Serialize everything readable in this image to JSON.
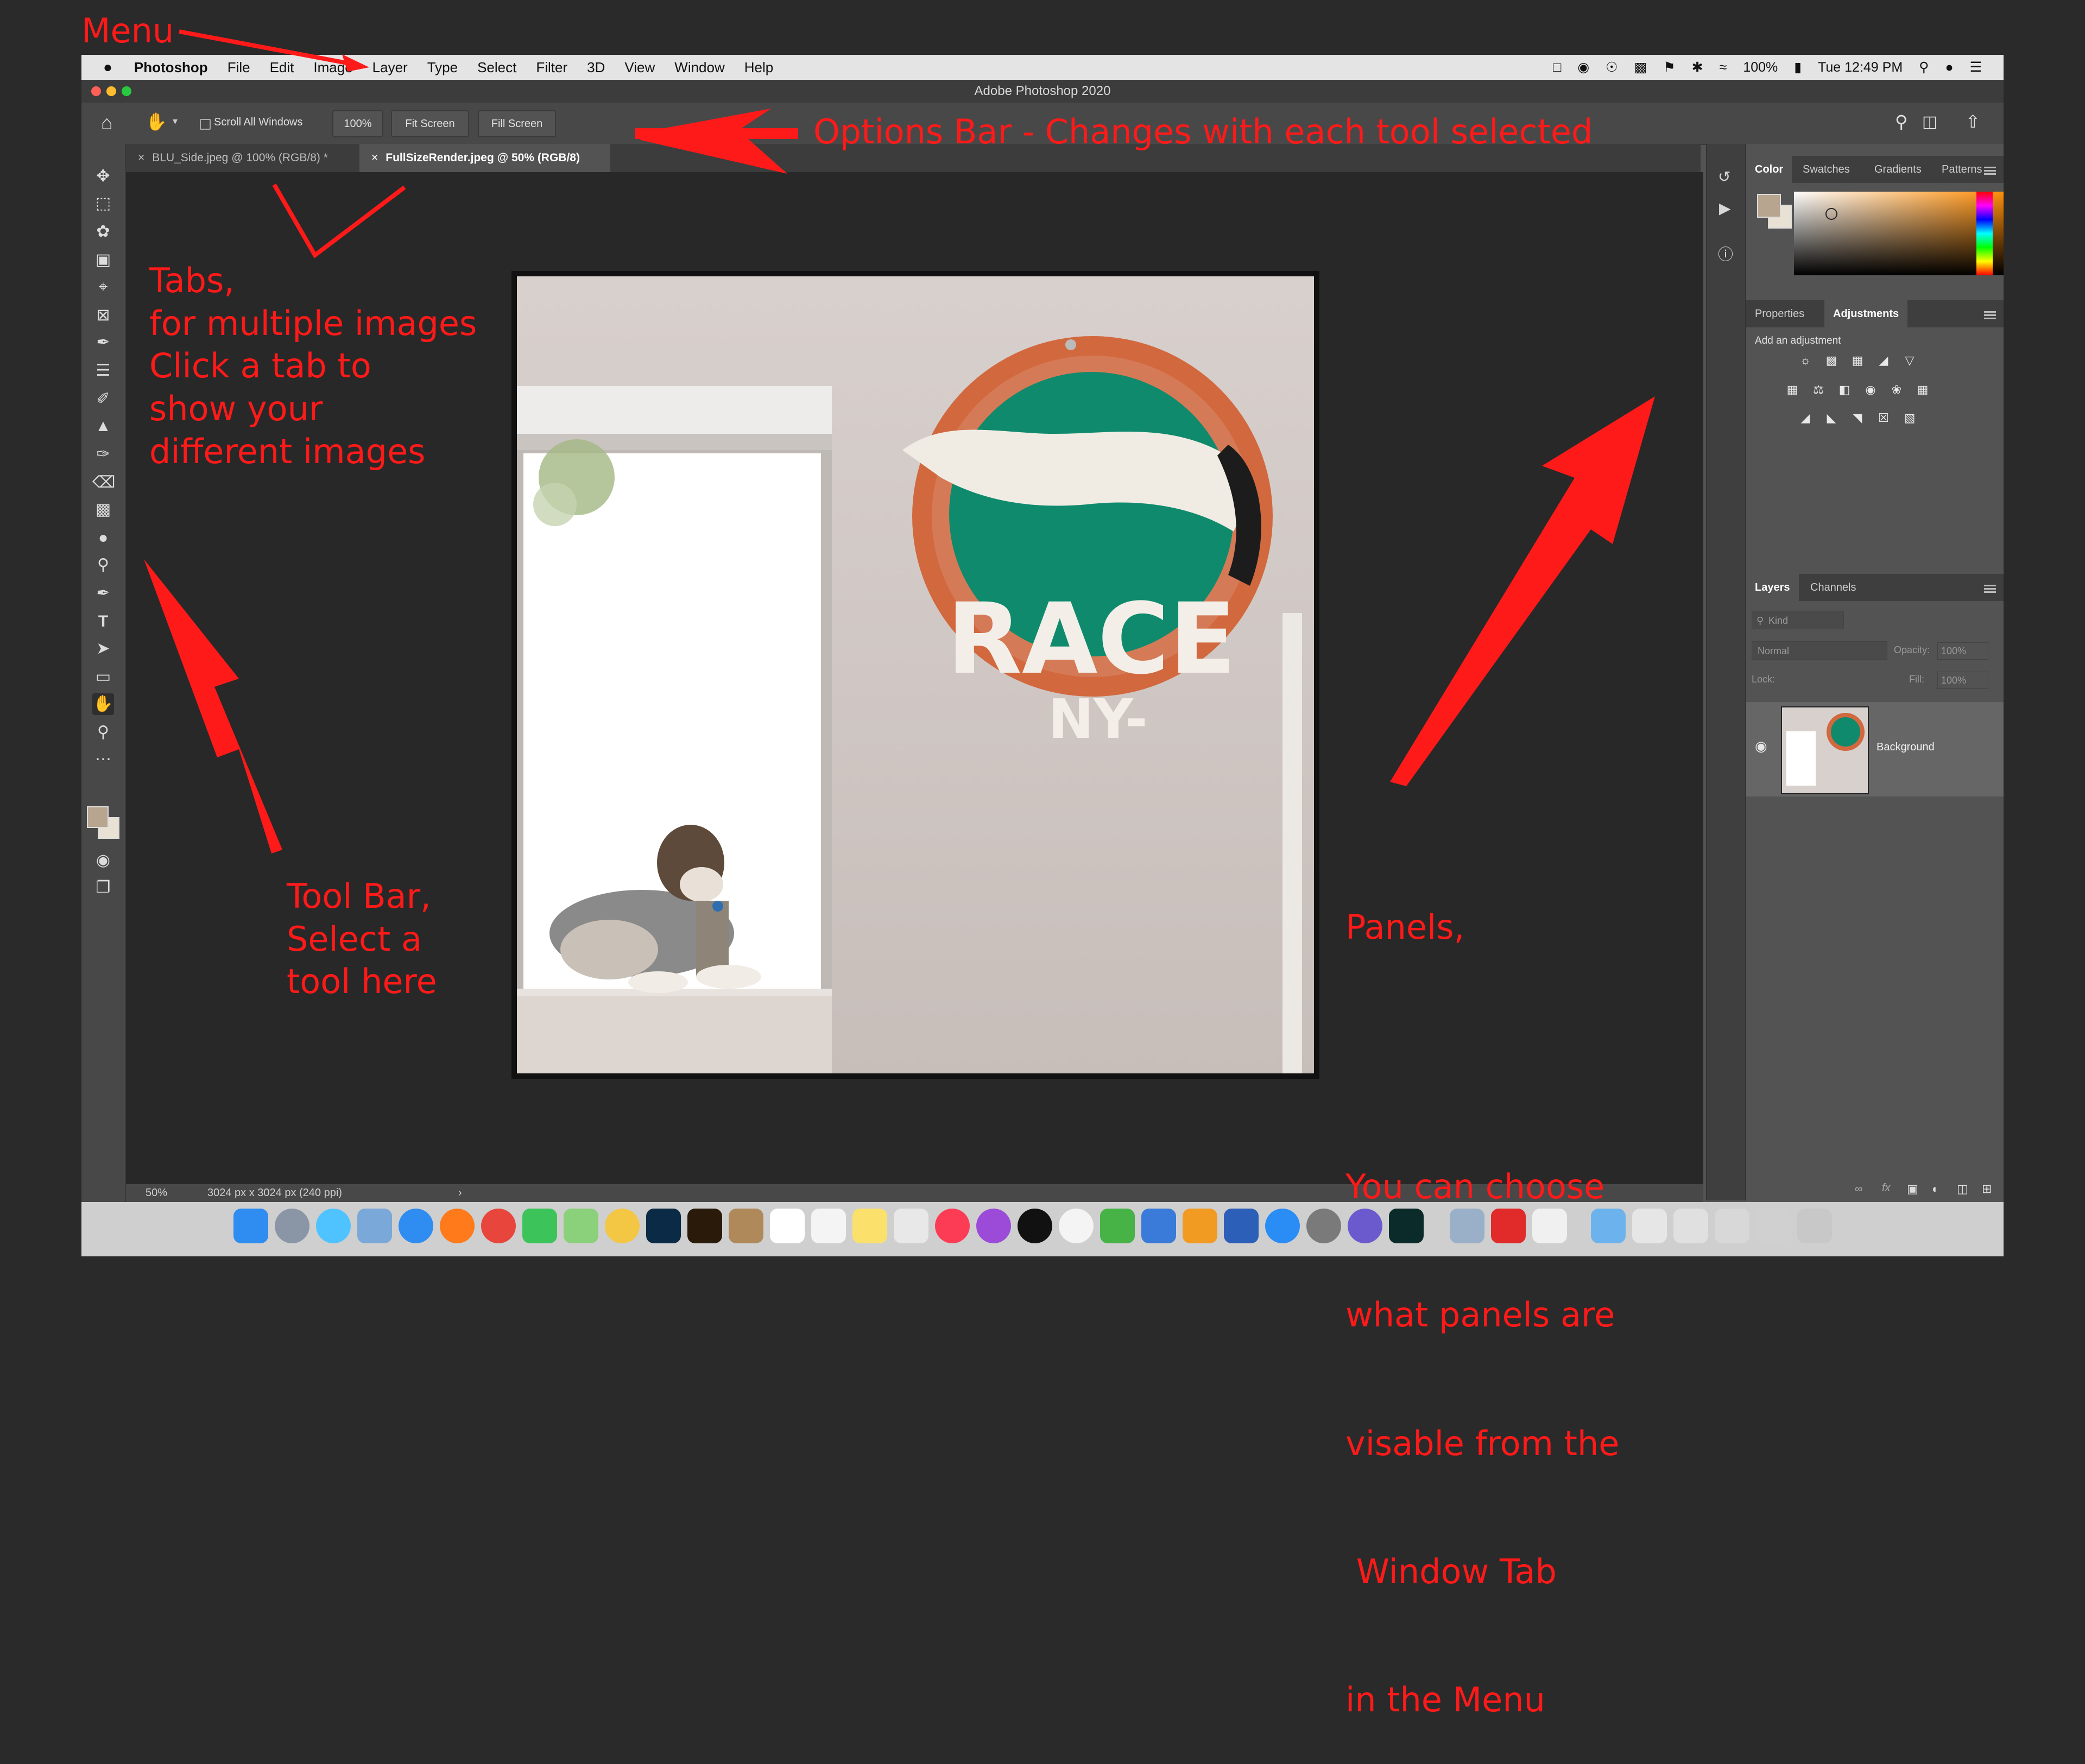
{
  "annotations": {
    "menu": "Menu",
    "options_bar": "Options Bar - Changes with each tool selected",
    "tabs": [
      "Tabs,",
      "for multiple images",
      "Click a tab to",
      "show your",
      "different images"
    ],
    "toolbar": [
      "Tool Bar,",
      "Select a",
      "tool here"
    ],
    "panels": [
      "Panels,",
      "",
      "You can choose",
      "what panels are",
      "visable from the",
      " Window Tab",
      "in the Menu"
    ]
  },
  "menubar": {
    "apple_icon": "apple-logo-icon",
    "items": [
      "Photoshop",
      "File",
      "Edit",
      "Image",
      "Layer",
      "Type",
      "Select",
      "Filter",
      "3D",
      "View",
      "Window",
      "Help"
    ],
    "battery": "100%",
    "clock": "Tue 12:49 PM"
  },
  "window": {
    "title": "Adobe Photoshop 2020"
  },
  "options_bar": {
    "scroll_all": "Scroll All Windows",
    "zoom": "100%",
    "fit_screen": "Fit Screen",
    "fill_screen": "Fill Screen"
  },
  "tabs": [
    {
      "label": "BLU_Side.jpeg @ 100% (RGB/8) *",
      "active": false
    },
    {
      "label": "FullSizeRender.jpeg @ 50% (RGB/8)",
      "active": true
    }
  ],
  "status": {
    "zoom": "50%",
    "info": "3024 px x 3024 px (240 ppi)"
  },
  "panel_color": {
    "tabs": [
      "Color",
      "Swatches",
      "Gradients",
      "Patterns"
    ]
  },
  "panel_adjust": {
    "tabs": [
      "Properties",
      "Adjustments"
    ],
    "add": "Add an adjustment"
  },
  "panel_layers": {
    "tabs": [
      "Layers",
      "Channels"
    ],
    "kind": "Kind",
    "blend": "Normal",
    "opacity_label": "Opacity:",
    "opacity": "100%",
    "lock_label": "Lock:",
    "fill_label": "Fill:",
    "fill": "100%",
    "layer_name": "Background"
  },
  "image": {
    "sign_text": "RACE",
    "sign_sub": "NY-"
  },
  "colors": {
    "accent": "#ff1a1a",
    "fg_swatch": "#b8a58f",
    "bg_swatch": "#e9e2d4"
  }
}
